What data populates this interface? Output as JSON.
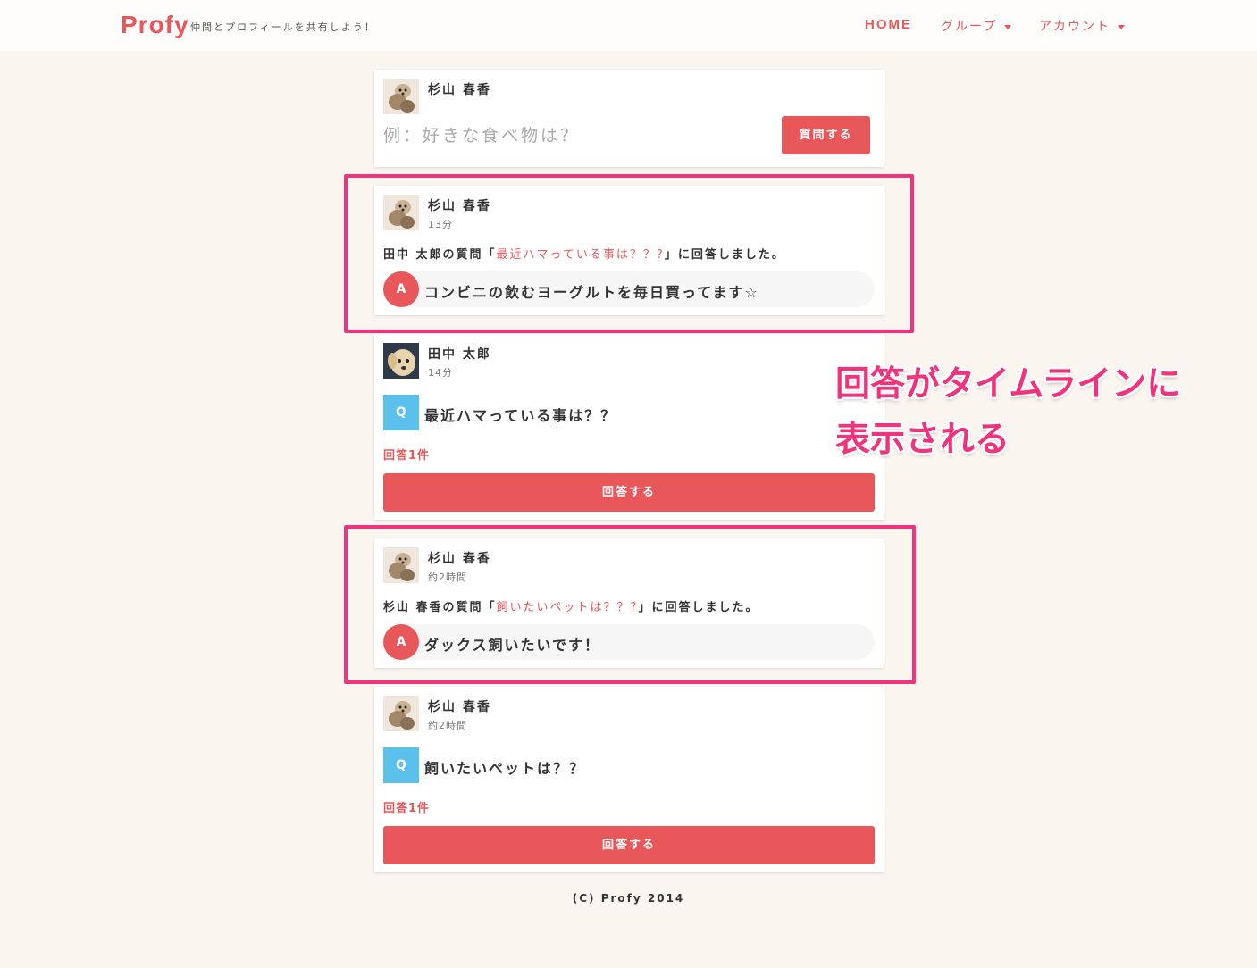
{
  "header": {
    "logo": "Profy",
    "tagline": "仲間とプロフィールを共有しよう！",
    "nav": {
      "home": "HOME",
      "group": "グループ",
      "account": "アカウント"
    }
  },
  "composer": {
    "user": "杉山 春香",
    "placeholder": "例：好きな食べ物は？",
    "ask_button": "質問する"
  },
  "posts": [
    {
      "type": "answer",
      "user": "杉山 春香",
      "time": "13分",
      "asker": "田中 太郎",
      "prefix": "の質問「",
      "question": "最近ハマっている事は？？?",
      "suffix": "」に回答しました。",
      "badge": "A",
      "answer": "コンビニの飲むヨーグルトを毎日買ってます☆"
    },
    {
      "type": "question",
      "user": "田中 太郎",
      "time": "14分",
      "badge": "Q",
      "question": "最近ハマっている事は？？",
      "count": "回答1件",
      "button": "回答する"
    },
    {
      "type": "answer",
      "user": "杉山 春香",
      "time": "約2時間",
      "asker": "杉山 春香",
      "prefix": "の質問「",
      "question": "飼いたいペットは？？?",
      "suffix": "」に回答しました。",
      "badge": "A",
      "answer": "ダックス飼いたいです！"
    },
    {
      "type": "question",
      "user": "杉山 春香",
      "time": "約2時間",
      "badge": "Q",
      "question": "飼いたいペットは？？",
      "count": "回答1件",
      "button": "回答する"
    }
  ],
  "annotation": {
    "line1": "回答がタイムラインに",
    "line2": "表示される"
  },
  "footer": "(C) Profy 2014",
  "colors": {
    "accent": "#e8575a",
    "question_badge": "#5bc0eb",
    "highlight": "#f0337a",
    "background": "#fbf5ef"
  }
}
